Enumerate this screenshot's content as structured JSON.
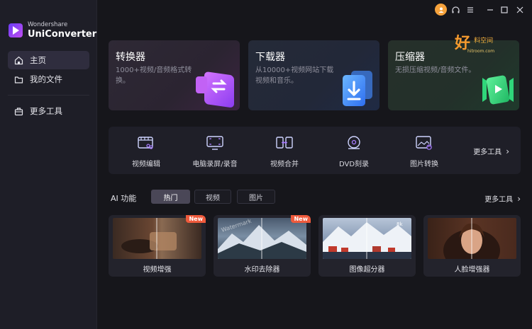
{
  "app": {
    "brand": "Wondershare",
    "name": "UniConverter"
  },
  "sidebar": {
    "items": [
      {
        "label": "主页",
        "icon": "home-icon",
        "active": true
      },
      {
        "label": "我的文件",
        "icon": "folder-icon",
        "active": false
      },
      {
        "label": "更多工具",
        "icon": "toolbox-icon",
        "active": false
      }
    ]
  },
  "titlebar": {
    "icons": [
      "avatar-icon",
      "headset-icon",
      "menu-icon",
      "minimize-icon",
      "maximize-icon",
      "close-icon"
    ]
  },
  "cards": [
    {
      "title": "转换器",
      "desc": "1000+视频/音频格式转换。",
      "icon": "converter-icon"
    },
    {
      "title": "下载器",
      "desc": "从10000+视频网站下载视频和音乐。",
      "icon": "download-icon"
    },
    {
      "title": "压缩器",
      "desc": "无损压缩视频/音频文件。",
      "icon": "compress-icon"
    }
  ],
  "watermark": {
    "text_main": "好",
    "text_sub": "料空间",
    "url": "hitroom.com"
  },
  "tools": {
    "items": [
      {
        "label": "视频编辑",
        "icon": "video-edit-icon"
      },
      {
        "label": "电脑录屏/录音",
        "icon": "screen-record-icon"
      },
      {
        "label": "视频合并",
        "icon": "merge-icon"
      },
      {
        "label": "DVD刻录",
        "icon": "dvd-icon"
      },
      {
        "label": "图片转换",
        "icon": "image-convert-icon"
      }
    ],
    "more_label": "更多工具"
  },
  "ai": {
    "title": "AI 功能",
    "tabs": [
      {
        "label": "热门",
        "active": true
      },
      {
        "label": "视频",
        "active": false
      },
      {
        "label": "图片",
        "active": false
      }
    ],
    "more_label": "更多工具",
    "cards": [
      {
        "label": "视频增强",
        "badge": "New"
      },
      {
        "label": "水印去除器",
        "badge": "New",
        "overlay": "Watermark"
      },
      {
        "label": "图像超分器",
        "badge": "",
        "overlay": "8k"
      },
      {
        "label": "人脸增强器",
        "badge": ""
      }
    ]
  },
  "colors": {
    "background": "#16161b",
    "sidebar": "#1e1e27",
    "active_nav": "#2f2d3e",
    "badge": "#ef5a3c",
    "converter": "#b85cf2",
    "downloader": "#3f8ff5",
    "compressor": "#2fd67a"
  }
}
